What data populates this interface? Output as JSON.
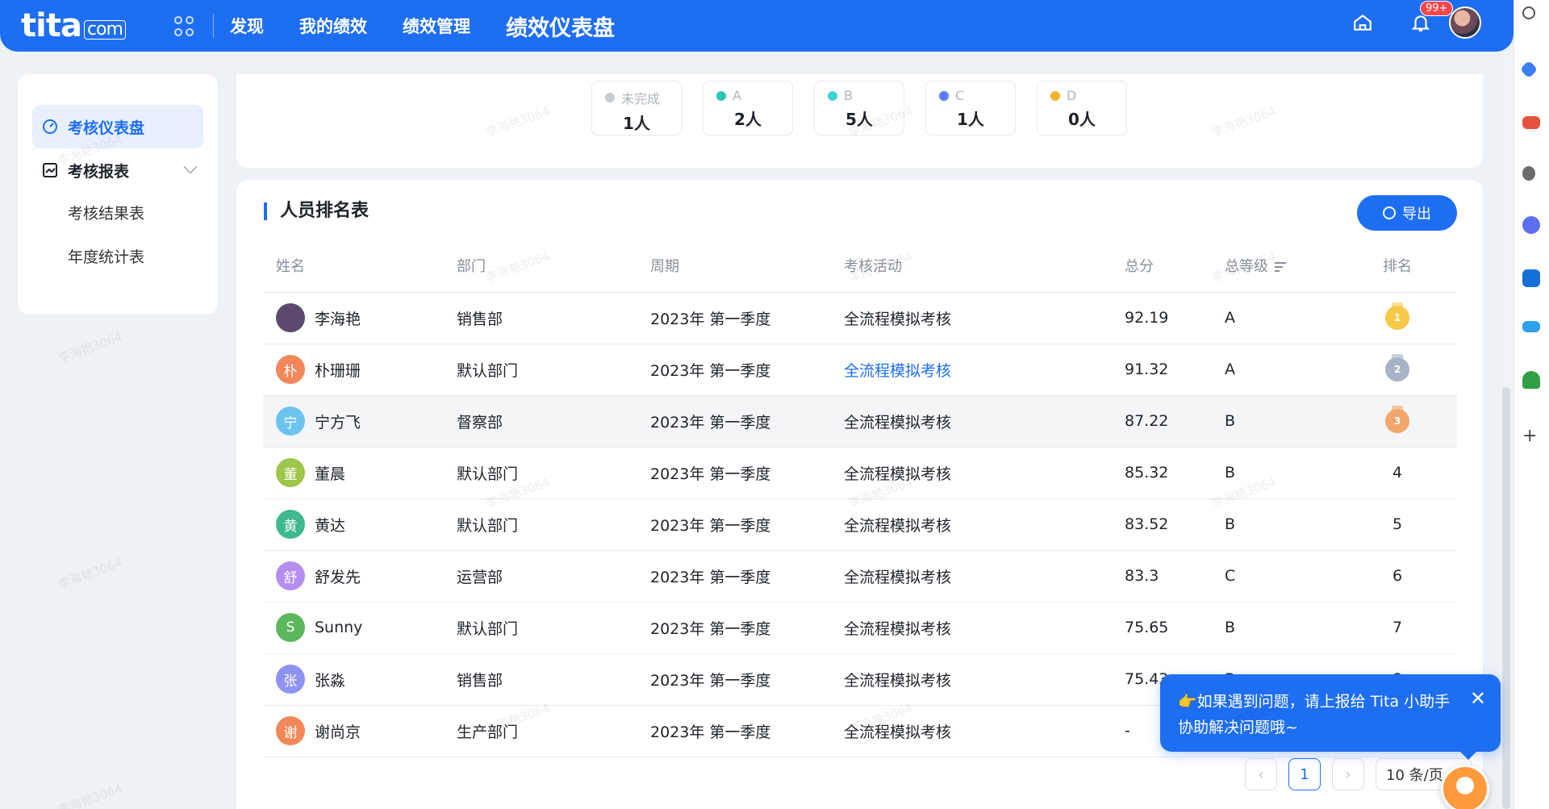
{
  "topbar": {
    "logo": "tita",
    "logo_domain": "com",
    "nav": [
      "发现",
      "我的绩效",
      "绩效管理",
      "绩效仪表盘"
    ],
    "notification_badge": "99+"
  },
  "sidebar": {
    "dashboard": "考核仪表盘",
    "reports": "考核报表",
    "result_table": "考核结果表",
    "annual_stats": "年度统计表"
  },
  "stats": [
    {
      "label": "未完成",
      "value": "1人",
      "color": "#c9ccd1"
    },
    {
      "label": "A",
      "value": "2人",
      "color": "#2ec7b8"
    },
    {
      "label": "B",
      "value": "5人",
      "color": "#3dd3d3"
    },
    {
      "label": "C",
      "value": "1人",
      "color": "#5b7ff5"
    },
    {
      "label": "D",
      "value": "0人",
      "color": "#f5b52a"
    }
  ],
  "ranking": {
    "title": "人员排名表",
    "export_label": "导出",
    "columns": {
      "name": "姓名",
      "dept": "部门",
      "period": "周期",
      "activity": "考核活动",
      "score": "总分",
      "grade": "总等级",
      "rank": "排名"
    },
    "rows": [
      {
        "initial": "",
        "name": "李海艳",
        "dept": "销售部",
        "period": "2023年 第一季度",
        "activity": "全流程模拟考核",
        "score": "92.19",
        "grade": "A",
        "rank": "1",
        "medal": "gold",
        "color": "#5b4a6e"
      },
      {
        "initial": "朴",
        "name": "朴珊珊",
        "dept": "默认部门",
        "period": "2023年 第一季度",
        "activity": "全流程模拟考核",
        "score": "91.32",
        "grade": "A",
        "rank": "2",
        "medal": "silver",
        "color": "#f2875a"
      },
      {
        "initial": "宁",
        "name": "宁方飞",
        "dept": "督察部",
        "period": "2023年 第一季度",
        "activity": "全流程模拟考核",
        "score": "87.22",
        "grade": "B",
        "rank": "3",
        "medal": "bronze",
        "color": "#6cc3ef"
      },
      {
        "initial": "董",
        "name": "董晨",
        "dept": "默认部门",
        "period": "2023年 第一季度",
        "activity": "全流程模拟考核",
        "score": "85.32",
        "grade": "B",
        "rank": "4",
        "medal": "",
        "color": "#9ec64a"
      },
      {
        "initial": "黄",
        "name": "黄达",
        "dept": "默认部门",
        "period": "2023年 第一季度",
        "activity": "全流程模拟考核",
        "score": "83.52",
        "grade": "B",
        "rank": "5",
        "medal": "",
        "color": "#3fb98e"
      },
      {
        "initial": "舒",
        "name": "舒发先",
        "dept": "运营部",
        "period": "2023年 第一季度",
        "activity": "全流程模拟考核",
        "score": "83.3",
        "grade": "C",
        "rank": "6",
        "medal": "",
        "color": "#b58ff0"
      },
      {
        "initial": "S",
        "name": "Sunny",
        "dept": "默认部门",
        "period": "2023年 第一季度",
        "activity": "全流程模拟考核",
        "score": "75.65",
        "grade": "B",
        "rank": "7",
        "medal": "",
        "color": "#5cb85c"
      },
      {
        "initial": "张",
        "name": "张淼",
        "dept": "销售部",
        "period": "2023年 第一季度",
        "activity": "全流程模拟考核",
        "score": "75.43",
        "grade": "B",
        "rank": "8",
        "medal": "",
        "color": "#8f92f0"
      },
      {
        "initial": "谢",
        "name": "谢尚京",
        "dept": "生产部门",
        "period": "2023年 第一季度",
        "activity": "全流程模拟考核",
        "score": "-",
        "grade": "",
        "rank": "",
        "medal": "",
        "color": "#f2875a"
      }
    ]
  },
  "pagination": {
    "prev": "‹",
    "current": "1",
    "next": "›",
    "page_size": "10 条/页"
  },
  "tip": {
    "text": "👉如果遇到问题，请上报给 Tita 小助手协助解决问题哦~",
    "close": "✕"
  },
  "watermark": "李海艳3064"
}
